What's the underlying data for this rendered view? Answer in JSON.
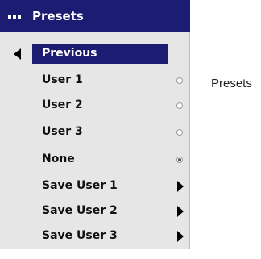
{
  "menu": {
    "title": "Presets",
    "previous_label": "Previous",
    "items": [
      {
        "label": "User 1",
        "control": "radio",
        "selected": false
      },
      {
        "label": "User 2",
        "control": "radio",
        "selected": false
      },
      {
        "label": "User 3",
        "control": "radio",
        "selected": false
      },
      {
        "label": "None",
        "control": "radio",
        "selected": true
      },
      {
        "label": "Save User 1",
        "control": "submenu"
      },
      {
        "label": "Save User 2",
        "control": "submenu"
      },
      {
        "label": "Save User 3",
        "control": "submenu"
      }
    ]
  },
  "caption": "Presets",
  "colors": {
    "header_bg": "#1c1c72",
    "menu_bg": "#e6e6e6",
    "text": "#111111"
  }
}
